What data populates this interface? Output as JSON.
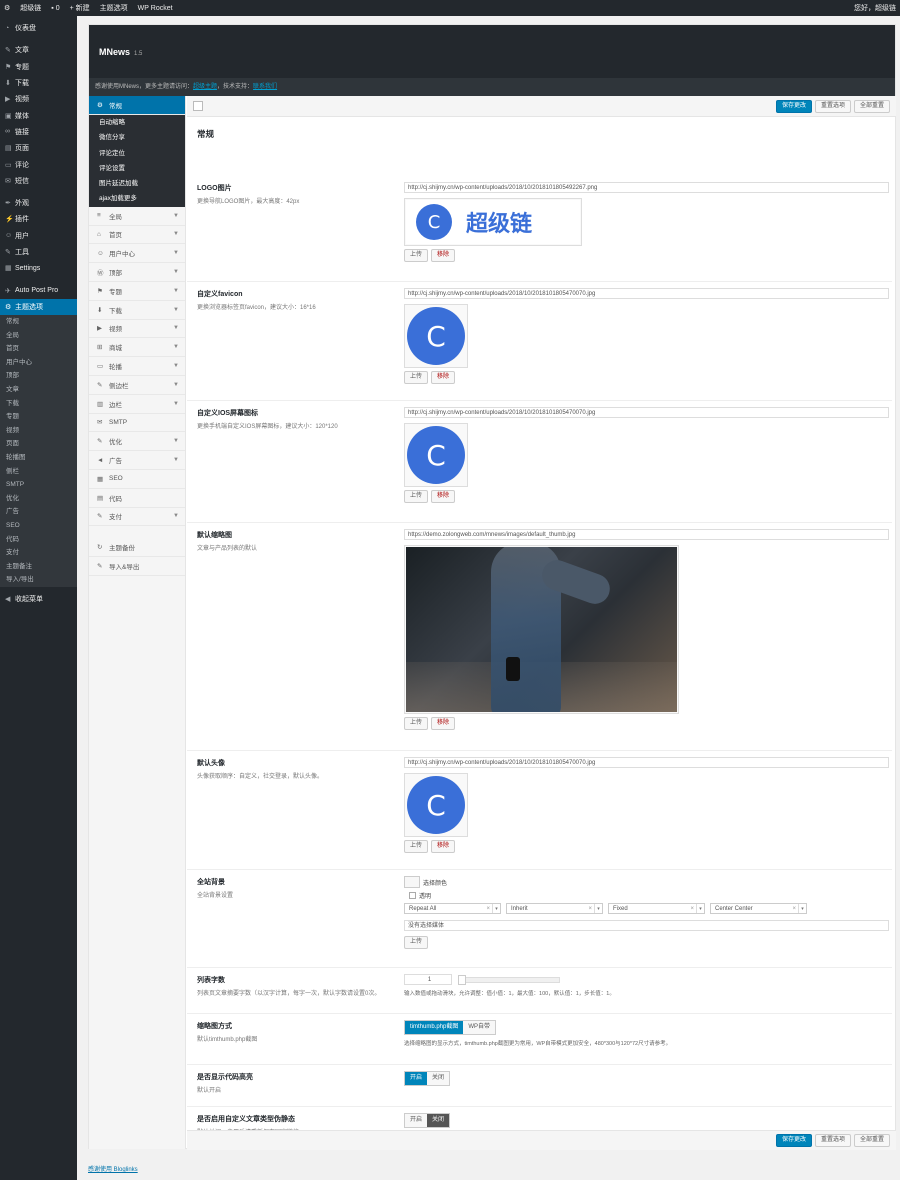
{
  "adminbar": {
    "site_name": "超级链",
    "comments": "0",
    "new": "新建",
    "theme_options": "主题选项",
    "plugin": "WP Rocket",
    "greeting": "您好，超级链"
  },
  "wpmenu": {
    "items": [
      {
        "label": "仪表盘",
        "icon": "dashboard-icon"
      },
      {
        "label": "文章",
        "icon": "pin-icon"
      },
      {
        "label": "专题",
        "icon": "flag-icon"
      },
      {
        "label": "下载",
        "icon": "download-icon"
      },
      {
        "label": "视频",
        "icon": "video-icon"
      },
      {
        "label": "媒体",
        "icon": "media-icon"
      },
      {
        "label": "链接",
        "icon": "link-icon"
      },
      {
        "label": "页面",
        "icon": "page-icon"
      },
      {
        "label": "评论",
        "icon": "comment-icon"
      },
      {
        "label": "短信",
        "icon": "mail-icon"
      },
      {
        "label": "外观",
        "icon": "brush-icon"
      },
      {
        "label": "插件",
        "icon": "plugin-icon"
      },
      {
        "label": "用户",
        "icon": "user-icon"
      },
      {
        "label": "工具",
        "icon": "wrench-icon"
      },
      {
        "label": "Settings",
        "icon": "settings-icon"
      },
      {
        "label": "Auto Post Pro",
        "icon": "bolt-icon"
      },
      {
        "label": "主题选项",
        "icon": "gear-icon"
      }
    ],
    "subitems": [
      "常规",
      "全局",
      "首页",
      "用户中心",
      "顶部",
      "文章",
      "下载",
      "专题",
      "视频",
      "页面",
      "轮播图",
      "侧栏",
      "SMTP",
      "优化",
      "广告",
      "SEO",
      "代码",
      "支付",
      "主题备注",
      "导入/导出"
    ],
    "collapse": "收起菜单"
  },
  "panel": {
    "title": "MNews",
    "version": "1.5",
    "notice_prefix": "感谢使用MNews，更多主题请访问：",
    "notice_link1": "超级主题",
    "notice_middle": "，技术支持：",
    "notice_link2": "联系我们"
  },
  "pnav": {
    "general": "常规",
    "general_subs": [
      "自动缩略",
      "微信分享",
      "评论定位",
      "评论设置",
      "图片延迟加载",
      "ajax加载更多"
    ],
    "items": [
      {
        "label": "全局",
        "icon": "list-icon",
        "chevron": true
      },
      {
        "label": "首页",
        "icon": "home-icon",
        "chevron": true
      },
      {
        "label": "用户中心",
        "icon": "user-icon",
        "chevron": true
      },
      {
        "label": "顶部",
        "icon": "wp-icon",
        "chevron": true
      },
      {
        "label": "专题",
        "icon": "flag-icon",
        "chevron": true
      },
      {
        "label": "下载",
        "icon": "download-icon",
        "chevron": true
      },
      {
        "label": "视频",
        "icon": "video-icon",
        "chevron": true
      },
      {
        "label": "商城",
        "icon": "cart-icon",
        "chevron": true
      },
      {
        "label": "轮播",
        "icon": "carousel-icon",
        "chevron": true
      },
      {
        "label": "侧边栏",
        "icon": "pin-icon",
        "chevron": true
      },
      {
        "label": "边栏",
        "icon": "sidebar-icon",
        "chevron": true
      },
      {
        "label": "SMTP",
        "icon": "mail-icon",
        "chevron": false
      },
      {
        "label": "优化",
        "icon": "wrench-icon",
        "chevron": true
      },
      {
        "label": "广告",
        "icon": "megaphone-icon",
        "chevron": true
      },
      {
        "label": "SEO",
        "icon": "seo-icon",
        "chevron": false
      },
      {
        "label": "代码",
        "icon": "code-icon",
        "chevron": false
      },
      {
        "label": "支付",
        "icon": "pen-icon",
        "chevron": true
      }
    ],
    "backup": "主题备份",
    "import_export": "导入&导出"
  },
  "toolbar": {
    "save": "保存更改",
    "reset_section": "重置选项",
    "reset_all": "全部重置"
  },
  "section": {
    "title": "常规"
  },
  "fields": {
    "logo": {
      "label": "LOGO图片",
      "desc": "更换导航LOGO图片，最大高度：42px",
      "url": "http://cj.shijmy.cn/wp-content/uploads/2018/10/2018101805492267.png",
      "logo_text": "超级链",
      "logo_letter": "C"
    },
    "favicon": {
      "label": "自定义favicon",
      "desc": "更换浏览器标签页favicon，建议大小：16*16",
      "url": "http://cj.shijmy.cn/wp-content/uploads/2018/10/2018101805470070.jpg",
      "letter": "C"
    },
    "ios_icon": {
      "label": "自定义IOS屏幕图标",
      "desc": "更换手机端自定义IOS屏幕图标，建议大小：120*120",
      "url": "http://cj.shijmy.cn/wp-content/uploads/2018/10/2018101805470070.jpg",
      "letter": "C"
    },
    "default_thumb": {
      "label": "默认缩略图",
      "desc": "文章与产品列表的默认",
      "url": "https://demo.zolongweb.com/mnews/images/default_thumb.jpg"
    },
    "default_avatar": {
      "label": "默认头像",
      "desc": "头像获取顺序：自定义，社交登录，默认头像。",
      "url": "http://cj.shijmy.cn/wp-content/uploads/2018/10/2018101805470070.jpg",
      "letter": "C"
    },
    "background": {
      "label": "全站背景",
      "desc": "全站背景设置",
      "color_label": "选择颜色",
      "transparent": "透明",
      "repeat": "Repeat All",
      "attachment_inherit": "Inherit",
      "fixed": "Fixed",
      "position": "Center Center",
      "media_placeholder": "没有选择媒体"
    },
    "excerpt": {
      "label": "列表字数",
      "desc": "列表页文章摘要字数（以汉字计算，每字一次，默认字数请设置0次。",
      "value": "1",
      "hint": "输入数值或拖动滑块，允许调整：值小值：1，最大值：100，默认值：1，步长值：1。"
    },
    "thumb_mode": {
      "label": "缩略图方式",
      "desc": "默认timthumb.php截图",
      "opt1": "timthumb.php截图",
      "opt2": "WP自带",
      "hint": "选择缩略图的显示方式，timthumb.php截图更为常用，WP自带模式更加安全，480*300与120*72尺寸请参考。"
    },
    "code_highlight": {
      "label": "是否显示代码高亮",
      "desc": "默认开启",
      "on": "开启",
      "off": "关闭"
    },
    "pseudo_static": {
      "label": "是否启用自定义文章类型伪静态",
      "desc": "默认关闭，启用后请重新保存固定链接。",
      "on": "开启",
      "off": "关闭"
    }
  },
  "buttons": {
    "upload": "上传",
    "remove": "移除"
  },
  "footer": {
    "credit": "感谢使用 Bloglinks"
  }
}
